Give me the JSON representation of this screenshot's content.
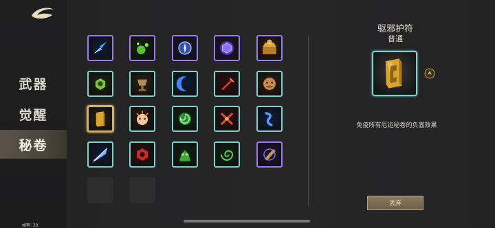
{
  "sidebar": {
    "logo_icon": "crescent-logo-icon",
    "items": [
      {
        "label": "武器",
        "active": false
      },
      {
        "label": "觉醒",
        "active": false
      },
      {
        "label": "秘卷",
        "active": true
      }
    ],
    "fps_label": "帧率: 30"
  },
  "grid": {
    "items": [
      {
        "icon": "blue-lightning-bolt-icon",
        "rarity": "epic"
      },
      {
        "icon": "green-poison-orbs-icon",
        "rarity": "epic"
      },
      {
        "icon": "blue-compass-orb-icon",
        "rarity": "epic"
      },
      {
        "icon": "purple-hexagon-gem-icon",
        "rarity": "epic"
      },
      {
        "icon": "golden-treasure-chest-icon",
        "rarity": "epic"
      },
      {
        "icon": "green-spiral-gem-icon",
        "rarity": "common"
      },
      {
        "icon": "bronze-chalice-icon",
        "rarity": "common"
      },
      {
        "icon": "blue-crescent-moon-icon",
        "rarity": "common"
      },
      {
        "icon": "red-flaming-sword-icon",
        "rarity": "common"
      },
      {
        "icon": "brown-scroll-face-icon",
        "rarity": "common"
      },
      {
        "icon": "golden-talisman-icon",
        "rarity": "common",
        "selected": true
      },
      {
        "icon": "exploding-creature-icon",
        "rarity": "common"
      },
      {
        "icon": "green-swirl-orb-icon",
        "rarity": "common"
      },
      {
        "icon": "red-crossed-blades-icon",
        "rarity": "common"
      },
      {
        "icon": "blue-wind-gust-icon",
        "rarity": "common"
      },
      {
        "icon": "blue-feather-blade-icon",
        "rarity": "common"
      },
      {
        "icon": "red-ring-sigil-icon",
        "rarity": "common"
      },
      {
        "icon": "green-clawed-beast-icon",
        "rarity": "common"
      },
      {
        "icon": "green-vortex-icon",
        "rarity": "common"
      },
      {
        "icon": "purple-rune-scroll-icon",
        "rarity": "epic"
      },
      {
        "icon": "empty-slot",
        "rarity": "none"
      },
      {
        "icon": "empty-slot",
        "rarity": "none"
      }
    ]
  },
  "detail": {
    "title": "驱邪护符",
    "quality": "普通",
    "icon": "golden-talisman-icon",
    "side_icon": "round-emblem-icon",
    "description": "免疫所有厄运秘卷的负面效果",
    "discard_label": "丢弃"
  },
  "colors": {
    "epic_border": "#9b7cf0",
    "common_border": "#7fd3cf",
    "selected_border": "#d4b16a",
    "sidebar_active": "#4a4439",
    "button_bg": "#7b6c54"
  }
}
